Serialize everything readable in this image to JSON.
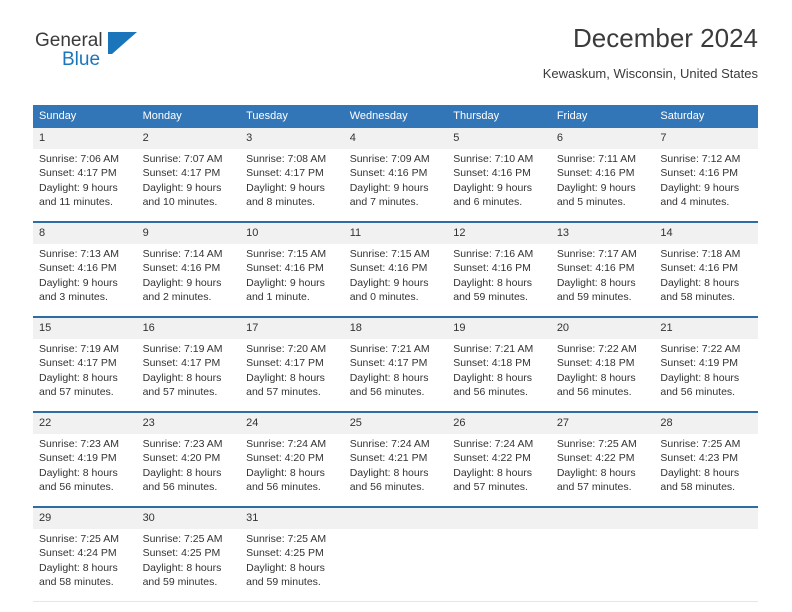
{
  "brand": {
    "name_part1": "General",
    "name_part2": "Blue",
    "accent_color": "#1b75bb"
  },
  "header": {
    "title": "December 2024",
    "subtitle": "Kewaskum, Wisconsin, United States"
  },
  "theme": {
    "header_bg": "#3276b8",
    "row_rule": "#2e6da4",
    "daynum_bg": "#f1f1f1",
    "text": "#333333"
  },
  "weekday_headers": [
    "Sunday",
    "Monday",
    "Tuesday",
    "Wednesday",
    "Thursday",
    "Friday",
    "Saturday"
  ],
  "weeks": [
    [
      {
        "day": "1",
        "sunrise": "Sunrise: 7:06 AM",
        "sunset": "Sunset: 4:17 PM",
        "daylight_line1": "Daylight: 9 hours",
        "daylight_line2": "and 11 minutes."
      },
      {
        "day": "2",
        "sunrise": "Sunrise: 7:07 AM",
        "sunset": "Sunset: 4:17 PM",
        "daylight_line1": "Daylight: 9 hours",
        "daylight_line2": "and 10 minutes."
      },
      {
        "day": "3",
        "sunrise": "Sunrise: 7:08 AM",
        "sunset": "Sunset: 4:17 PM",
        "daylight_line1": "Daylight: 9 hours",
        "daylight_line2": "and 8 minutes."
      },
      {
        "day": "4",
        "sunrise": "Sunrise: 7:09 AM",
        "sunset": "Sunset: 4:16 PM",
        "daylight_line1": "Daylight: 9 hours",
        "daylight_line2": "and 7 minutes."
      },
      {
        "day": "5",
        "sunrise": "Sunrise: 7:10 AM",
        "sunset": "Sunset: 4:16 PM",
        "daylight_line1": "Daylight: 9 hours",
        "daylight_line2": "and 6 minutes."
      },
      {
        "day": "6",
        "sunrise": "Sunrise: 7:11 AM",
        "sunset": "Sunset: 4:16 PM",
        "daylight_line1": "Daylight: 9 hours",
        "daylight_line2": "and 5 minutes."
      },
      {
        "day": "7",
        "sunrise": "Sunrise: 7:12 AM",
        "sunset": "Sunset: 4:16 PM",
        "daylight_line1": "Daylight: 9 hours",
        "daylight_line2": "and 4 minutes."
      }
    ],
    [
      {
        "day": "8",
        "sunrise": "Sunrise: 7:13 AM",
        "sunset": "Sunset: 4:16 PM",
        "daylight_line1": "Daylight: 9 hours",
        "daylight_line2": "and 3 minutes."
      },
      {
        "day": "9",
        "sunrise": "Sunrise: 7:14 AM",
        "sunset": "Sunset: 4:16 PM",
        "daylight_line1": "Daylight: 9 hours",
        "daylight_line2": "and 2 minutes."
      },
      {
        "day": "10",
        "sunrise": "Sunrise: 7:15 AM",
        "sunset": "Sunset: 4:16 PM",
        "daylight_line1": "Daylight: 9 hours",
        "daylight_line2": "and 1 minute."
      },
      {
        "day": "11",
        "sunrise": "Sunrise: 7:15 AM",
        "sunset": "Sunset: 4:16 PM",
        "daylight_line1": "Daylight: 9 hours",
        "daylight_line2": "and 0 minutes."
      },
      {
        "day": "12",
        "sunrise": "Sunrise: 7:16 AM",
        "sunset": "Sunset: 4:16 PM",
        "daylight_line1": "Daylight: 8 hours",
        "daylight_line2": "and 59 minutes."
      },
      {
        "day": "13",
        "sunrise": "Sunrise: 7:17 AM",
        "sunset": "Sunset: 4:16 PM",
        "daylight_line1": "Daylight: 8 hours",
        "daylight_line2": "and 59 minutes."
      },
      {
        "day": "14",
        "sunrise": "Sunrise: 7:18 AM",
        "sunset": "Sunset: 4:16 PM",
        "daylight_line1": "Daylight: 8 hours",
        "daylight_line2": "and 58 minutes."
      }
    ],
    [
      {
        "day": "15",
        "sunrise": "Sunrise: 7:19 AM",
        "sunset": "Sunset: 4:17 PM",
        "daylight_line1": "Daylight: 8 hours",
        "daylight_line2": "and 57 minutes."
      },
      {
        "day": "16",
        "sunrise": "Sunrise: 7:19 AM",
        "sunset": "Sunset: 4:17 PM",
        "daylight_line1": "Daylight: 8 hours",
        "daylight_line2": "and 57 minutes."
      },
      {
        "day": "17",
        "sunrise": "Sunrise: 7:20 AM",
        "sunset": "Sunset: 4:17 PM",
        "daylight_line1": "Daylight: 8 hours",
        "daylight_line2": "and 57 minutes."
      },
      {
        "day": "18",
        "sunrise": "Sunrise: 7:21 AM",
        "sunset": "Sunset: 4:17 PM",
        "daylight_line1": "Daylight: 8 hours",
        "daylight_line2": "and 56 minutes."
      },
      {
        "day": "19",
        "sunrise": "Sunrise: 7:21 AM",
        "sunset": "Sunset: 4:18 PM",
        "daylight_line1": "Daylight: 8 hours",
        "daylight_line2": "and 56 minutes."
      },
      {
        "day": "20",
        "sunrise": "Sunrise: 7:22 AM",
        "sunset": "Sunset: 4:18 PM",
        "daylight_line1": "Daylight: 8 hours",
        "daylight_line2": "and 56 minutes."
      },
      {
        "day": "21",
        "sunrise": "Sunrise: 7:22 AM",
        "sunset": "Sunset: 4:19 PM",
        "daylight_line1": "Daylight: 8 hours",
        "daylight_line2": "and 56 minutes."
      }
    ],
    [
      {
        "day": "22",
        "sunrise": "Sunrise: 7:23 AM",
        "sunset": "Sunset: 4:19 PM",
        "daylight_line1": "Daylight: 8 hours",
        "daylight_line2": "and 56 minutes."
      },
      {
        "day": "23",
        "sunrise": "Sunrise: 7:23 AM",
        "sunset": "Sunset: 4:20 PM",
        "daylight_line1": "Daylight: 8 hours",
        "daylight_line2": "and 56 minutes."
      },
      {
        "day": "24",
        "sunrise": "Sunrise: 7:24 AM",
        "sunset": "Sunset: 4:20 PM",
        "daylight_line1": "Daylight: 8 hours",
        "daylight_line2": "and 56 minutes."
      },
      {
        "day": "25",
        "sunrise": "Sunrise: 7:24 AM",
        "sunset": "Sunset: 4:21 PM",
        "daylight_line1": "Daylight: 8 hours",
        "daylight_line2": "and 56 minutes."
      },
      {
        "day": "26",
        "sunrise": "Sunrise: 7:24 AM",
        "sunset": "Sunset: 4:22 PM",
        "daylight_line1": "Daylight: 8 hours",
        "daylight_line2": "and 57 minutes."
      },
      {
        "day": "27",
        "sunrise": "Sunrise: 7:25 AM",
        "sunset": "Sunset: 4:22 PM",
        "daylight_line1": "Daylight: 8 hours",
        "daylight_line2": "and 57 minutes."
      },
      {
        "day": "28",
        "sunrise": "Sunrise: 7:25 AM",
        "sunset": "Sunset: 4:23 PM",
        "daylight_line1": "Daylight: 8 hours",
        "daylight_line2": "and 58 minutes."
      }
    ],
    [
      {
        "day": "29",
        "sunrise": "Sunrise: 7:25 AM",
        "sunset": "Sunset: 4:24 PM",
        "daylight_line1": "Daylight: 8 hours",
        "daylight_line2": "and 58 minutes."
      },
      {
        "day": "30",
        "sunrise": "Sunrise: 7:25 AM",
        "sunset": "Sunset: 4:25 PM",
        "daylight_line1": "Daylight: 8 hours",
        "daylight_line2": "and 59 minutes."
      },
      {
        "day": "31",
        "sunrise": "Sunrise: 7:25 AM",
        "sunset": "Sunset: 4:25 PM",
        "daylight_line1": "Daylight: 8 hours",
        "daylight_line2": "and 59 minutes."
      },
      {
        "day": "",
        "sunrise": "",
        "sunset": "",
        "daylight_line1": "",
        "daylight_line2": ""
      },
      {
        "day": "",
        "sunrise": "",
        "sunset": "",
        "daylight_line1": "",
        "daylight_line2": ""
      },
      {
        "day": "",
        "sunrise": "",
        "sunset": "",
        "daylight_line1": "",
        "daylight_line2": ""
      },
      {
        "day": "",
        "sunrise": "",
        "sunset": "",
        "daylight_line1": "",
        "daylight_line2": ""
      }
    ]
  ]
}
